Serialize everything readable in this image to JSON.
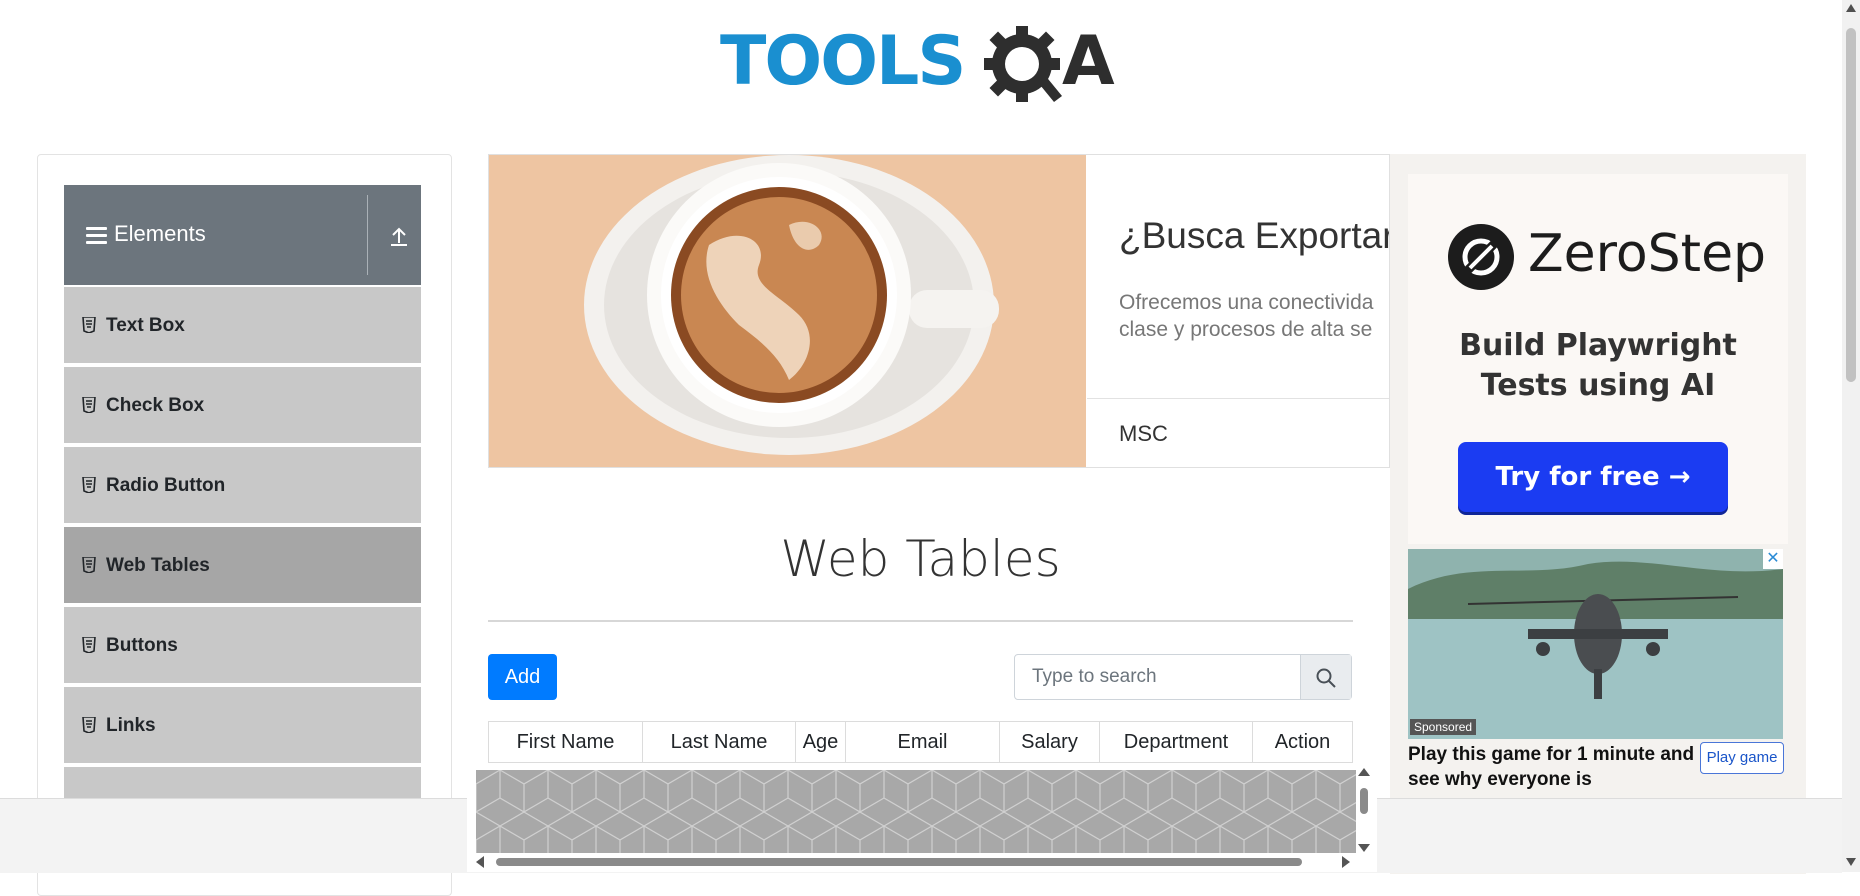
{
  "header": {
    "logo_text_primary": "TOOLS",
    "logo_text_secondary": "A"
  },
  "sidebar": {
    "group_title": "Elements",
    "items": [
      {
        "label": "Text Box",
        "active": false
      },
      {
        "label": "Check Box",
        "active": false
      },
      {
        "label": "Radio Button",
        "active": false
      },
      {
        "label": "Web Tables",
        "active": true
      },
      {
        "label": "Buttons",
        "active": false
      },
      {
        "label": "Links",
        "active": false
      }
    ]
  },
  "banner_ad": {
    "title": "¿Busca Exportar",
    "description_line1": "Ofrecemos una conectivida",
    "description_line2": "clase y procesos de alta se",
    "brand": "MSC"
  },
  "side_ad": {
    "brand_name": "ZeroStep",
    "headline_line1": "Build Playwright",
    "headline_line2": "Tests using AI",
    "cta_label": "Try for free →",
    "close_label": "✕",
    "sponsored_label": "Sponsored",
    "game_text": "Play this game for 1 minute and see why everyone is",
    "game_button_label": "Play game",
    "cta_color": "#1b3cf2"
  },
  "main": {
    "page_title": "Web Tables",
    "add_button_label": "Add",
    "search": {
      "placeholder": "Type to search",
      "value": ""
    },
    "table": {
      "columns": [
        "First Name",
        "Last Name",
        "Age",
        "Email",
        "Salary",
        "Department",
        "Action"
      ]
    }
  },
  "colors": {
    "accent_blue": "#007bff",
    "sidebar_header": "#6c757d",
    "sidebar_item": "#c8c8c8",
    "sidebar_item_active": "#a6a6a6",
    "logo_blue": "#1a8fd0"
  }
}
